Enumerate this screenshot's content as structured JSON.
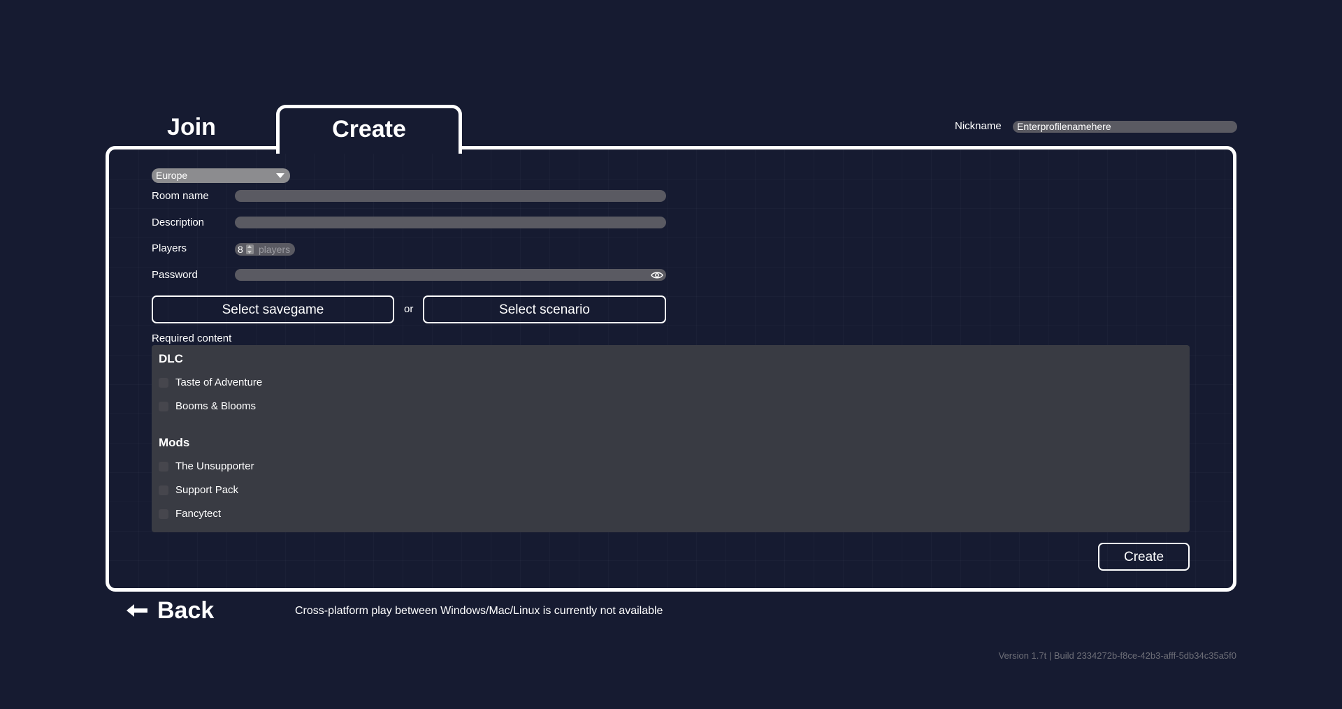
{
  "tabs": {
    "join": "Join",
    "create": "Create"
  },
  "nickname": {
    "label": "Nickname",
    "value": "Enterprofilenamehere"
  },
  "form": {
    "region": "Europe",
    "room_name_label": "Room name",
    "room_name_value": "",
    "description_label": "Description",
    "description_value": "",
    "players_label": "Players",
    "players_value": "8",
    "players_unit": "players",
    "password_label": "Password",
    "password_value": "",
    "select_savegame": "Select savegame",
    "or": "or",
    "select_scenario": "Select scenario",
    "required_content_label": "Required content"
  },
  "required_content": {
    "dlc_title": "DLC",
    "dlc": [
      {
        "label": "Taste of Adventure",
        "checked": false
      },
      {
        "label": "Booms & Blooms",
        "checked": false
      }
    ],
    "mods_title": "Mods",
    "mods": [
      {
        "label": "The Unsupporter",
        "checked": false
      },
      {
        "label": "Support Pack",
        "checked": false
      },
      {
        "label": "Fancytect",
        "checked": false
      }
    ]
  },
  "create_button": "Create",
  "back_button": "Back",
  "notice": "Cross-platform play between Windows/Mac/Linux is currently not available",
  "version": "Version 1.7t | Build 2334272b-f8ce-42b3-afff-5db34c35a5f0",
  "colors": {
    "background": "#161b31",
    "input": "#5a5a62",
    "content_box": "#393b43",
    "border": "#ffffff"
  }
}
